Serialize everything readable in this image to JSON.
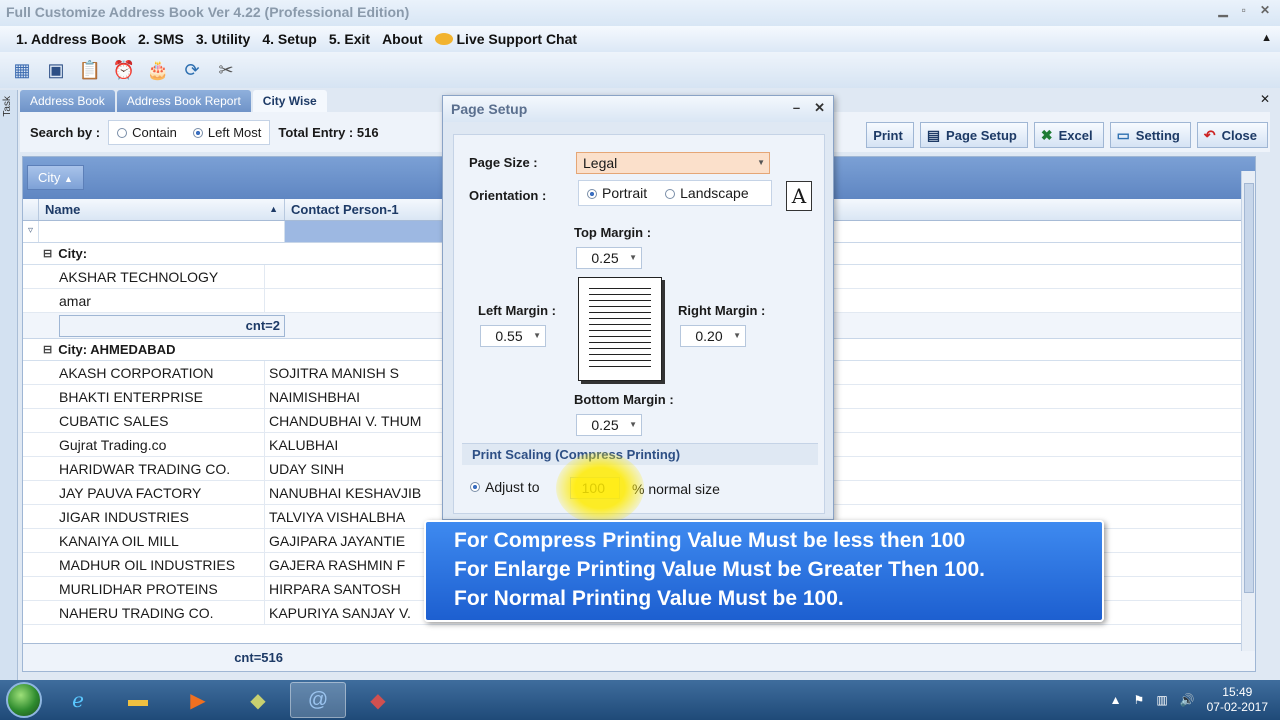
{
  "window": {
    "title": "Full Customize Address Book Ver 4.22 (Professional Edition)"
  },
  "menu": [
    "1. Address Book",
    "2. SMS",
    "3. Utility",
    "4. Setup",
    "5. Exit",
    "About",
    "Live Support Chat"
  ],
  "taskstrip_label": "Task",
  "tabs": [
    "Address Book",
    "Address Book Report",
    "City Wise"
  ],
  "search": {
    "label": "Search by :",
    "opt_contain": "Contain",
    "opt_leftmost": "Left Most",
    "total": "Total Entry : 516"
  },
  "buttons": {
    "print": "Print",
    "page_setup": "Page Setup",
    "excel": "Excel",
    "setting": "Setting",
    "close": "Close"
  },
  "grid": {
    "group_chip": "City",
    "col_name": "Name",
    "col_contact": "Contact Person-1",
    "group1": {
      "label": "City:",
      "rows": [
        [
          "AKSHAR TECHNOLOGY",
          ""
        ],
        [
          "amar",
          ""
        ]
      ],
      "cnt": "cnt=2"
    },
    "group2": {
      "label": "City: AHMEDABAD",
      "rows": [
        [
          "AKASH CORPORATION",
          "SOJITRA MANISH S"
        ],
        [
          "BHAKTI ENTERPRISE",
          "NAIMISHBHAI"
        ],
        [
          "CUBATIC SALES",
          "CHANDUBHAI V. THUM"
        ],
        [
          "Gujrat Trading.co",
          "KALUBHAI"
        ],
        [
          "HARIDWAR TRADING CO.",
          "UDAY SINH"
        ],
        [
          "JAY PAUVA FACTORY",
          "NANUBHAI KESHAVJIB"
        ],
        [
          "JIGAR INDUSTRIES",
          "TALVIYA VISHALBHA"
        ],
        [
          "KANAIYA OIL MILL",
          "GAJIPARA JAYANTIE"
        ],
        [
          "MADHUR OIL INDUSTRIES",
          "GAJERA RASHMIN F"
        ],
        [
          "MURLIDHAR PROTEINS",
          "HIRPARA SANTOSH"
        ],
        [
          "NAHERU TRADING CO.",
          "KAPURIYA SANJAY V."
        ]
      ]
    },
    "footer_cnt": "cnt=516"
  },
  "dialog": {
    "title": "Page Setup",
    "page_size_label": "Page Size :",
    "page_size": "Legal",
    "orientation_label": "Orientation :",
    "portrait": "Portrait",
    "landscape": "Landscape",
    "top_margin_label": "Top Margin :",
    "top_margin": "0.25",
    "left_margin_label": "Left Margin :",
    "left_margin": "0.55",
    "right_margin_label": "Right Margin :",
    "right_margin": "0.20",
    "bottom_margin_label": "Bottom Margin :",
    "bottom_margin": "0.25",
    "scaling_header": "Print Scaling (Compress Printing)",
    "adjust_to": "Adjust to",
    "adjust_value": "100",
    "normal_size": "% normal size"
  },
  "callout": [
    "For Compress Printing Value Must be less then 100",
    "For Enlarge Printing Value Must be Greater Then 100.",
    "For Normal Printing Value Must be 100."
  ],
  "taskbar": {
    "time": "15:49",
    "date": "07-02-2017"
  }
}
